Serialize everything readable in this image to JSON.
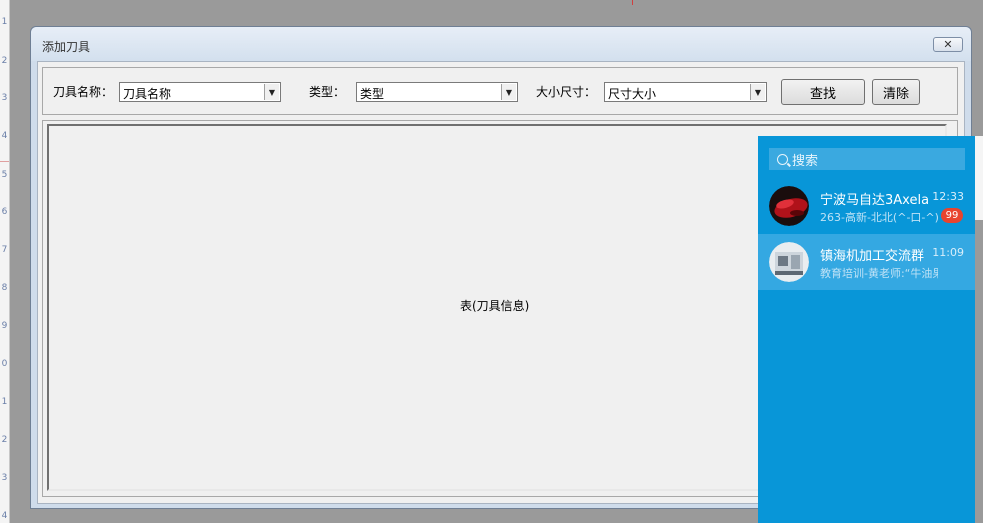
{
  "ruler": {
    "ticks": [
      "1",
      "2",
      "3",
      "4",
      "5",
      "6",
      "7",
      "8",
      "9",
      "0",
      "1",
      "2",
      "3",
      "4"
    ]
  },
  "dialog": {
    "title": "添加刀具",
    "close_glyph": "✕",
    "search": {
      "name_label": "刀具名称：",
      "name_value": "刀具名称",
      "type_label": "类型：",
      "type_value": "类型",
      "size_label": "大小尺寸：",
      "size_value": "尺寸大小",
      "find_label": "查找",
      "clear_label": "清除",
      "dropdown_glyph": "▼"
    },
    "table_caption": "表(刀具信息)"
  },
  "chat": {
    "search_placeholder": "搜索",
    "conversations": [
      {
        "name": "宁波马自达3Axela",
        "time": "12:33",
        "preview": "263-高新-北北(^-口-^)",
        "badge": "99",
        "selected": false
      },
      {
        "name": "镇海机加工交流群",
        "time": "11:09",
        "preview": "教育培训-黄老师:“牛油果",
        "badge": "",
        "selected": true
      }
    ]
  },
  "colors": {
    "chat_bg": "#0896d8",
    "chat_selected": "#34a8e2",
    "badge": "#e8442e",
    "dialog_frame": "#cfdceb"
  }
}
